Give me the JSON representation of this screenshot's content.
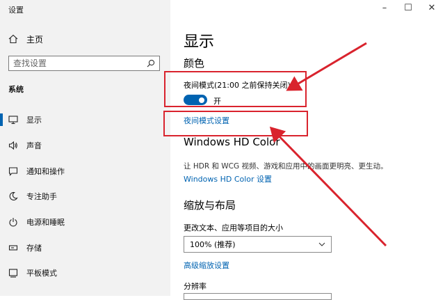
{
  "window": {
    "title": "设置",
    "minimize": "–",
    "maximize": "☐",
    "close": "✕"
  },
  "sidebar": {
    "home": "主页",
    "search_placeholder": "查找设置",
    "section": "系统",
    "items": [
      {
        "label": "显示",
        "icon": "monitor-icon"
      },
      {
        "label": "声音",
        "icon": "speaker-icon"
      },
      {
        "label": "通知和操作",
        "icon": "notification-icon"
      },
      {
        "label": "专注助手",
        "icon": "moon-icon"
      },
      {
        "label": "电源和睡眠",
        "icon": "power-icon"
      },
      {
        "label": "存储",
        "icon": "storage-icon"
      },
      {
        "label": "平板模式",
        "icon": "tablet-icon"
      }
    ]
  },
  "main": {
    "title": "显示",
    "color_heading": "颜色",
    "night_mode_label": "夜间模式(21:00 之前保持关闭)",
    "night_mode_state": "开",
    "night_mode_settings_link": "夜间模式设置",
    "hdr_heading": "Windows HD Color",
    "hdr_description": "让 HDR 和 WCG 视频、游戏和应用中的画面更明亮、更生动。",
    "hdr_settings_link": "Windows HD Color 设置",
    "scale_heading": "缩放与布局",
    "scale_label": "更改文本、应用等项目的大小",
    "scale_value": "100% (推荐)",
    "advanced_scale_link": "高级缩放设置",
    "resolution_label": "分辨率"
  },
  "colors": {
    "accent": "#0063b1",
    "annotation": "#d9232d",
    "sidebar_bg": "#f2f2f2"
  }
}
